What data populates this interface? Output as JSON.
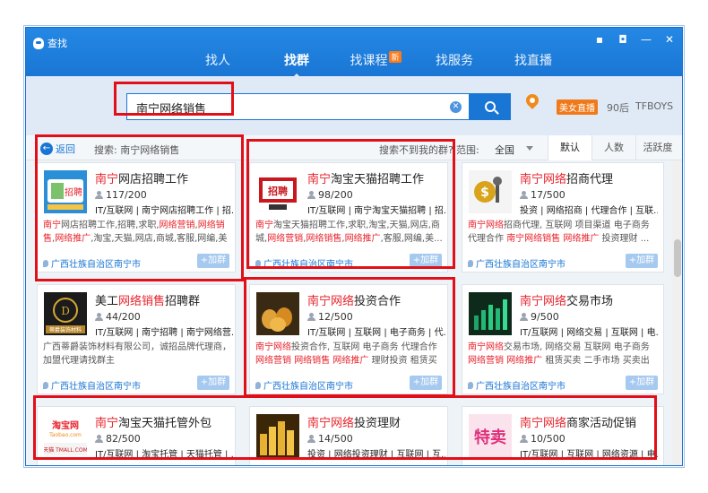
{
  "window": {
    "title": "查找"
  },
  "nav": [
    {
      "label": "找人"
    },
    {
      "label": "找群"
    },
    {
      "label": "找课程",
      "badge": "新"
    },
    {
      "label": "找服务"
    },
    {
      "label": "找直播"
    }
  ],
  "search": {
    "value": "南宁网络销售"
  },
  "hot_tags": [
    "美女直播",
    "90后",
    "TFBOYS"
  ],
  "results_bar": {
    "back": "返回",
    "crumb": "搜索: 南宁网络销售",
    "not_found": "搜索不到我的群?",
    "range_label": "范围:",
    "range_value": "全国",
    "sort_tabs": [
      "默认",
      "人数",
      "活跃度"
    ]
  },
  "cards": [
    {
      "title_hl": "南宁",
      "title_rest": "网店招聘工作",
      "members": "117/200",
      "tags": "IT/互联网 | 南宁网店招聘工作 | 招...",
      "desc": "南宁网店招聘工作,招聘,求职,网络营销,网络销售,网络推广,淘宝,天猫,网店,商城,客服,网编,美工,...",
      "location": "广西壮族自治区南宁市",
      "join": "+加群"
    },
    {
      "title_hl": "南宁",
      "title_rest": "淘宝天猫招聘工作",
      "members": "98/200",
      "tags": "IT/互联网 | 南宁淘宝天猫招聘 | 招...",
      "desc": "南宁淘宝天猫招聘工作,求职,淘宝,天猫,网店,商城,网络营销,网络销售,网络推广,客服,网编,美...",
      "location": "广西壮族自治区南宁市",
      "join": "+加群"
    },
    {
      "title_hl": "南宁网络",
      "title_rest": "招商代理",
      "members": "17/500",
      "tags": "投资 | 网络招商 | 代理合作 | 互联...",
      "desc": "南宁网络招商代理, 互联网 项目渠道 电子商务 代理合作 南宁网络销售 网络推广 投资理财 ...",
      "location": "广西壮族自治区南宁市",
      "join": "+加群"
    },
    {
      "title_hl": "",
      "title_pre": "美工",
      "title_hl2": "网络销售",
      "title_rest": "招聘群",
      "members": "44/200",
      "tags": "IT/互联网 | 南宁招聘 | 南宁网络营...",
      "desc": "广西蒂爵装饰材料有限公司，诚招品牌代理商，加盟代理请找群主",
      "location": "广西壮族自治区南宁市",
      "join": "+加群"
    },
    {
      "title_hl": "南宁网络",
      "title_rest": "投资合作",
      "members": "12/500",
      "tags": "IT/互联网 | 互联网 | 电子商务 | 代...",
      "desc": "南宁网络投资合作, 互联网 电子商务 代理合作 网络营销 网络销售 网络推广 理财投资 租赁买卖 ...",
      "location": "广西壮族自治区南宁市",
      "join": "+加群"
    },
    {
      "title_hl": "南宁网络",
      "title_rest": "交易市场",
      "members": "9/500",
      "tags": "IT/互联网 | 网络交易 | 互联网 | 电...",
      "desc": "南宁网络交易市场, 网络交易 互联网 电子商务 网络营销 网络推广 租赁买卖 二手市场 买卖出售 ...",
      "location": "广西壮族自治区南宁市",
      "join": "+加群"
    },
    {
      "title_hl": "南宁",
      "title_rest": "淘宝天猫托管外包",
      "members": "82/500",
      "tags": "IT/互联网 | 淘宝托管 | 天猫托管 | ...",
      "desc": "",
      "location": "",
      "join": ""
    },
    {
      "title_hl": "南宁网络",
      "title_rest": "投资理财",
      "members": "14/500",
      "tags": "投资 | 网络投资理财 | 互联网 | 互...",
      "desc": "",
      "location": "",
      "join": ""
    },
    {
      "title_hl": "南宁网络",
      "title_rest": "商家活动促销",
      "members": "10/500",
      "tags": "IT/互联网 | 互联网 | 网络资源 | 电...",
      "desc": "",
      "location": "",
      "join": ""
    }
  ],
  "thumbs": [
    {
      "caption": "招聘"
    },
    {
      "caption": "招聘"
    },
    {
      "caption": ""
    },
    {
      "caption": "蒂爵装饰材料"
    },
    {
      "caption": ""
    },
    {
      "caption": ""
    },
    {
      "caption": "淘宝网",
      "caption2": "Taobao.com",
      "caption3": "天猫 TMALL.COM"
    },
    {
      "caption": ""
    },
    {
      "caption": "特卖"
    }
  ],
  "colors": {
    "accent": "#1a76d4",
    "highlight": "#e8232c",
    "annotation": "#e30f18"
  }
}
